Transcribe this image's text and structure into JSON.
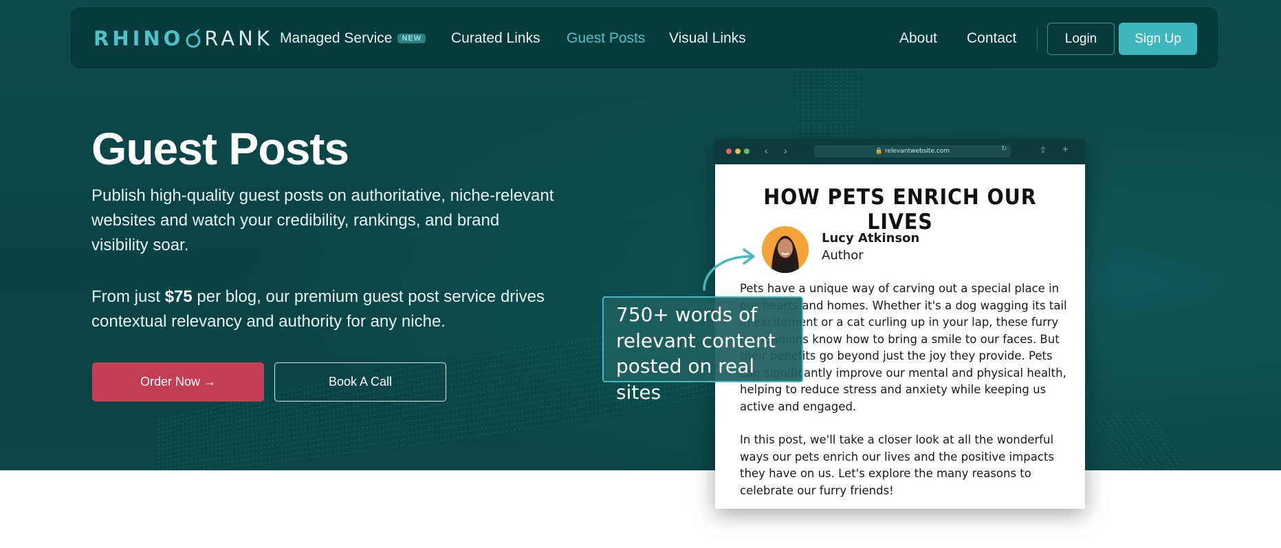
{
  "colors": {
    "hero_bg": "#0b4547",
    "accent": "#4fc2c9",
    "primary_button": "#c33d55",
    "signup_button": "#3fb5be"
  },
  "nav": {
    "logo_left": "RHINO",
    "logo_right": "RANK",
    "logo_icon": "rhino-horn-icon",
    "links": {
      "managed": "Managed Service",
      "managed_badge": "NEW",
      "curated": "Curated Links",
      "guest": "Guest Posts",
      "visual": "Visual Links",
      "about": "About",
      "contact": "Contact"
    },
    "active_link": "Guest Posts",
    "login": "Login",
    "signup": "Sign Up"
  },
  "hero": {
    "title": "Guest Posts",
    "paragraph1": "Publish high-quality guest posts on authoritative, niche-relevant websites and watch your credibility, rankings, and brand visibility soar.",
    "paragraph2_before": "From just ",
    "paragraph2_price": "$75",
    "paragraph2_after": " per blog, our premium guest post service drives contextual relevancy and authority for any niche.",
    "order_button": "Order Now →",
    "call_button": "Book A Call"
  },
  "browser": {
    "url": "relevantwebsite.com",
    "icons": [
      "back-icon",
      "forward-icon",
      "lock-icon",
      "reload-icon",
      "share-icon",
      "new-tab-icon"
    ],
    "article_title": "HOW PETS ENRICH OUR LIVES",
    "author_name": "Lucy Atkinson",
    "author_role": "Author",
    "para1": "Pets have a unique way of carving out a special place in our hearts and homes. Whether it's a dog wagging its tail in excitement or a cat curling up in your lap, these furry companions know how to bring a smile to our faces. But their benefits go beyond just the joy they provide. Pets can significantly improve our mental and physical health, helping to reduce stress and anxiety while keeping us active and engaged.",
    "para2": "In this post, we'll take a closer look at all the wonderful ways our pets enrich our lives and the positive impacts they have on us. Let's explore the many reasons to celebrate our furry friends!"
  },
  "callout": {
    "text": "750+ words of relevant content posted on real sites"
  }
}
